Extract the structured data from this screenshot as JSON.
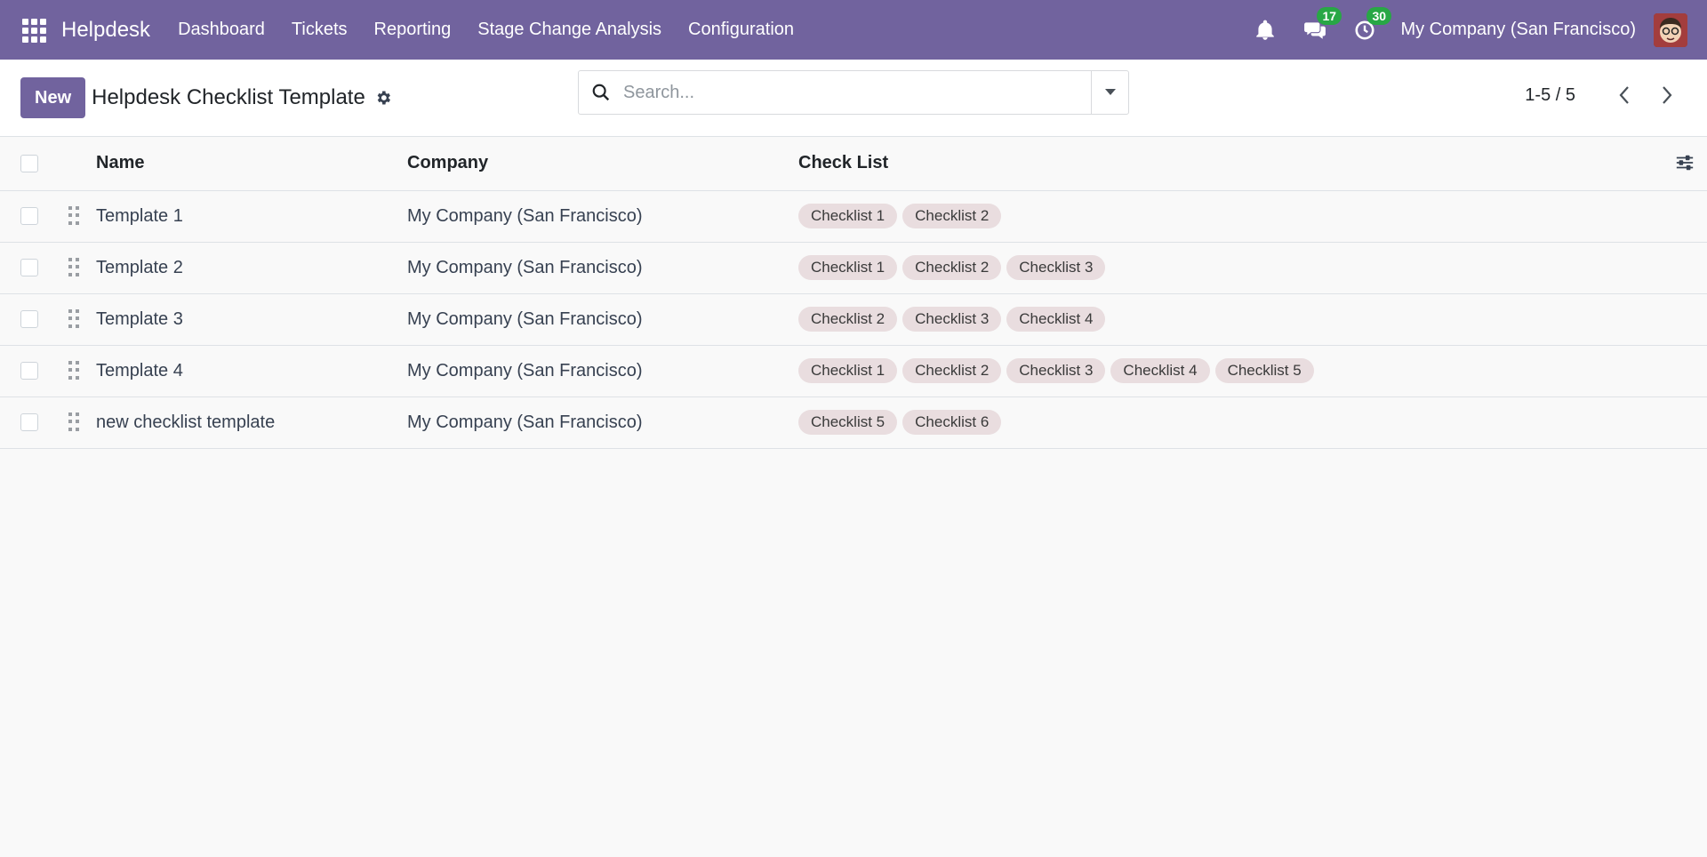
{
  "navbar": {
    "brand": "Helpdesk",
    "menu": [
      "Dashboard",
      "Tickets",
      "Reporting",
      "Stage Change Analysis",
      "Configuration"
    ],
    "messages_count": "17",
    "activities_count": "30",
    "company": "My Company (San Francisco)",
    "accent_color": "#71639e"
  },
  "control_panel": {
    "new_label": "New",
    "title": "Helpdesk Checklist Template",
    "search_placeholder": "Search...",
    "pager_value": "1-5 / 5"
  },
  "table": {
    "headers": {
      "name": "Name",
      "company": "Company",
      "checklist": "Check List"
    },
    "rows": [
      {
        "name": "Template 1",
        "company": "My Company (San Francisco)",
        "tags": [
          "Checklist 1",
          "Checklist 2"
        ]
      },
      {
        "name": "Template 2",
        "company": "My Company (San Francisco)",
        "tags": [
          "Checklist 1",
          "Checklist 2",
          "Checklist 3"
        ]
      },
      {
        "name": "Template 3",
        "company": "My Company (San Francisco)",
        "tags": [
          "Checklist 2",
          "Checklist 3",
          "Checklist 4"
        ]
      },
      {
        "name": "Template 4",
        "company": "My Company (San Francisco)",
        "tags": [
          "Checklist 1",
          "Checklist 2",
          "Checklist 3",
          "Checklist 4",
          "Checklist 5"
        ]
      },
      {
        "name": "new checklist template",
        "company": "My Company (San Francisco)",
        "tags": [
          "Checklist 5",
          "Checklist 6"
        ]
      }
    ]
  }
}
